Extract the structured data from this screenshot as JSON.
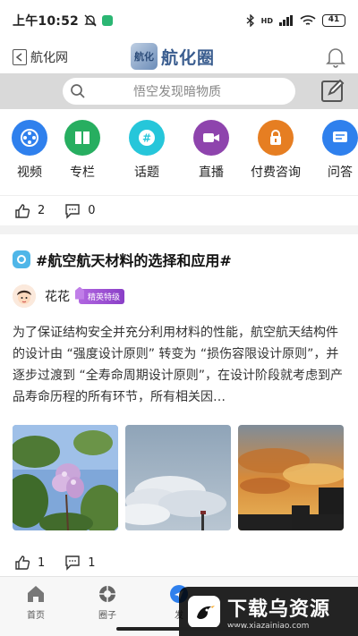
{
  "status": {
    "time": "上午10:52",
    "signal": "HD",
    "battery": "41"
  },
  "header": {
    "back_label": "航化网",
    "logo_text": "航化圈",
    "logo_mark": "航化"
  },
  "search": {
    "placeholder": "悟空发现暗物质"
  },
  "categories": [
    {
      "label": "视频",
      "color": "#2f80ed",
      "icon": "film-reel-icon"
    },
    {
      "label": "专栏",
      "color": "#27ae60",
      "icon": "book-icon"
    },
    {
      "label": "话题",
      "color": "#26c6da",
      "icon": "hashtag-icon"
    },
    {
      "label": "直播",
      "color": "#8e44ad",
      "icon": "video-camera-icon"
    },
    {
      "label": "付费咨询",
      "color": "#e67e22",
      "icon": "lock-icon"
    },
    {
      "label": "问答",
      "color": "#2f80ed",
      "icon": "question-icon"
    }
  ],
  "prev_post": {
    "likes": "2",
    "comments": "0"
  },
  "post": {
    "topic": "#航空航天材料的选择和应用#",
    "author": "花花",
    "badge": "精英特级",
    "body": "为了保证结构安全并充分利用材料的性能，航空航天结构件的设计由 “强度设计原则” 转变为 “损伤容限设计原则”，并逐步过渡到 “全寿命周期设计原则”，在设计阶段就考虑到产品寿命历程的所有环节，所有相关因…",
    "likes": "1",
    "comments": "1"
  },
  "nav": [
    {
      "label": "首页",
      "icon": "home-icon"
    },
    {
      "label": "圈子",
      "icon": "aperture-icon"
    },
    {
      "label": "发",
      "icon": "publish-icon"
    }
  ],
  "watermark": {
    "title": "下载乌资源",
    "url": "www.xiazainiao.com"
  }
}
